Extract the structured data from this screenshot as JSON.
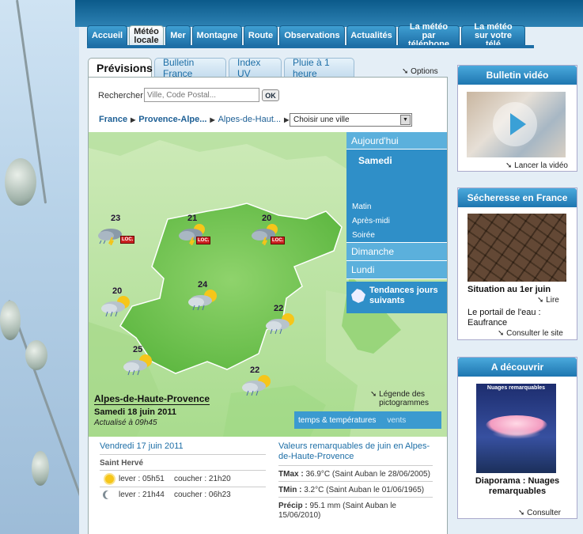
{
  "nav": {
    "tabs": [
      "Accueil",
      "Météo locale",
      "Mer",
      "Montagne",
      "Route",
      "Observations",
      "Actualités",
      "La météo par téléphone",
      "La météo sur votre télé"
    ]
  },
  "subtabs": [
    "Prévisions",
    "Bulletin France",
    "Index UV",
    "Pluie à 1 heure"
  ],
  "options_label": "Options",
  "search": {
    "label": "Rechercher",
    "placeholder": "Ville, Code Postal...",
    "ok": "OK"
  },
  "breadcrumb": {
    "country": "France",
    "region": "Provence-Alpe...",
    "dept": "Alpes-de-Haut...",
    "city_select": "Choisir une ville"
  },
  "days": {
    "today": "Aujourd'hui",
    "saturday": "Samedi",
    "morning": "Matin",
    "afternoon": "Après-midi",
    "evening": "Soirée",
    "sunday": "Dimanche",
    "monday": "Lundi",
    "trends": "Tendances jours suivants"
  },
  "map": {
    "cities": [
      {
        "temp": "23",
        "icon": "storm-icon",
        "loc": "LOC."
      },
      {
        "temp": "21",
        "icon": "storm-icon",
        "loc": "LOC."
      },
      {
        "temp": "20",
        "icon": "storm-icon",
        "loc": "LOC."
      },
      {
        "temp": "20",
        "icon": "sun-cloud-rain-icon"
      },
      {
        "temp": "24",
        "icon": "sun-cloud-rain-icon"
      },
      {
        "temp": "22",
        "icon": "sun-cloud-rain-icon"
      },
      {
        "temp": "25",
        "icon": "sun-cloud-rain-icon"
      },
      {
        "temp": "22",
        "icon": "sun-cloud-rain-icon"
      }
    ],
    "region_name": "Alpes-de-Haute-Provence",
    "date": "Samedi 18 juin 2011",
    "updated": "Actualisé à 09h45",
    "legend": "Légende des pictogrammes",
    "layer": "temps & températures",
    "layer_alt": "vents"
  },
  "ephemeris": {
    "date": "Vendredi 17 juin 2011",
    "saint": "Saint Hervé",
    "sun": "lever : 05h51",
    "sun_set": "coucher : 21h20",
    "moon": "lever : 21h44",
    "moon_set": "coucher : 06h23"
  },
  "records": {
    "title": "Valeurs remarquables de juin en Alpes-de-Haute-Provence",
    "tmax_label": "TMax :",
    "tmax": "36.9°C (Saint Auban le 28/06/2005)",
    "tmin_label": "TMin :",
    "tmin": "3.2°C (Saint Auban le 01/06/1965)",
    "precip_label": "Précip :",
    "precip": "95.1 mm (Saint Auban le 15/06/2010)"
  },
  "right": {
    "video": {
      "title": "Bulletin vidéo",
      "link": "Lancer la vidéo"
    },
    "drought": {
      "title": "Sécheresse en France",
      "caption": "Situation au 1er juin",
      "read": "Lire",
      "portal": "Le portail de l'eau : Eaufrance",
      "site": "Consulter le site"
    },
    "discover": {
      "title": "A découvrir",
      "thumb_title": "Nuages remarquables",
      "caption": "Diaporama : Nuages remarquables",
      "link": "Consulter"
    }
  },
  "colors": {
    "accent": "#1d6ea6",
    "day_menu": "#3b9ad0",
    "map_green": "#7cc95a",
    "loc_red": "#c22222"
  }
}
